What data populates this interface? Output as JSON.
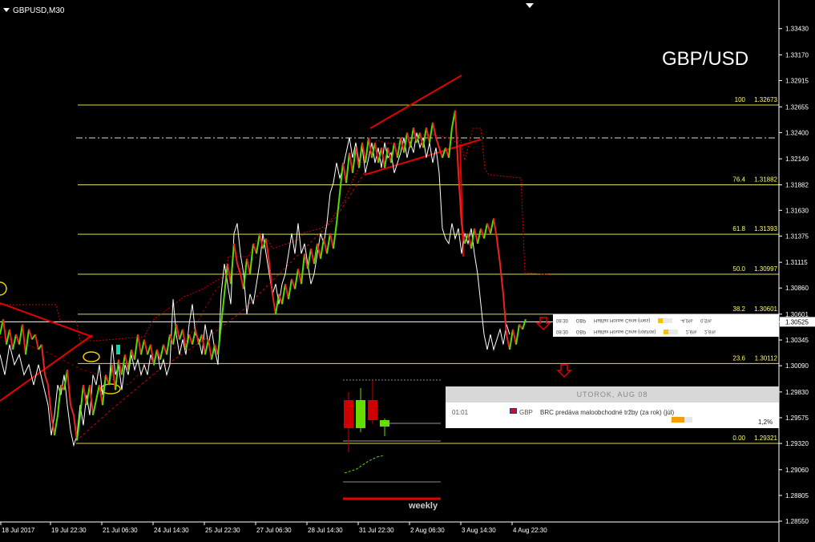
{
  "symbol": "GBPUSD,M30",
  "big_title": "GBP/USD",
  "chart_data": {
    "type": "line",
    "instrument": "GBPUSD",
    "timeframe": "M30",
    "ylim": [
      1.2855,
      1.3365
    ],
    "y_ticks": [
      "1.33430",
      "1.33170",
      "1.32915",
      "1.32655",
      "1.32400",
      "1.32140",
      "1.31882",
      "1.31630",
      "1.31375",
      "1.31115",
      "1.30860",
      "1.30601",
      "1.30525",
      "1.30345",
      "1.30090",
      "1.29830",
      "1.29575",
      "1.29320",
      "1.29060",
      "1.28805",
      "1.28550"
    ],
    "x_ticks": [
      "18 Jul 2017",
      "19 Jul 22:30",
      "21 Jul 06:30",
      "24 Jul 14:30",
      "25 Jul 22:30",
      "27 Jul 06:30",
      "28 Jul 14:30",
      "31 Jul 22:30",
      "2 Aug 06:30",
      "3 Aug 14:30",
      "4 Aug 22:30"
    ],
    "current_price": "1.30525",
    "fibonacci": [
      {
        "level": "100",
        "price": "1.32673",
        "value": 1.32673
      },
      {
        "level": "76.4",
        "price": "1.31882",
        "value": 1.31882
      },
      {
        "level": "61.8",
        "price": "1.31393",
        "value": 1.31393
      },
      {
        "level": "50.0",
        "price": "1.30997",
        "value": 1.30997
      },
      {
        "level": "38.2",
        "price": "1.30601",
        "value": 1.30601
      },
      {
        "level": "23.6",
        "price": "1.30112",
        "value": 1.30112
      },
      {
        "level": "0.00",
        "price": "1.29321",
        "value": 1.29321
      }
    ],
    "price_path": [
      [
        0,
        1.304
      ],
      [
        4,
        1.3055
      ],
      [
        8,
        1.303
      ],
      [
        12,
        1.3045
      ],
      [
        16,
        1.3025
      ],
      [
        20,
        1.304
      ],
      [
        24,
        1.303
      ],
      [
        28,
        1.305
      ],
      [
        32,
        1.302
      ],
      [
        36,
        1.3045
      ],
      [
        40,
        1.3035
      ],
      [
        44,
        1.304
      ],
      [
        48,
        1.3025
      ],
      [
        52,
        1.303
      ],
      [
        56,
        1.3
      ],
      [
        60,
        1.299
      ],
      [
        64,
        1.296
      ],
      [
        68,
        1.294
      ],
      [
        72,
        1.296
      ],
      [
        76,
        1.299
      ],
      [
        80,
        1.2985
      ],
      [
        84,
        1.3005
      ],
      [
        88,
        1.297
      ],
      [
        92,
        1.296
      ],
      [
        96,
        1.2935
      ],
      [
        100,
        1.296
      ],
      [
        104,
        1.299
      ],
      [
        108,
        1.297
      ],
      [
        112,
        1.299
      ],
      [
        116,
        1.296
      ],
      [
        120,
        1.2975
      ],
      [
        124,
        1.299
      ],
      [
        128,
        1.297
      ],
      [
        132,
        1.3
      ],
      [
        136,
        1.299
      ],
      [
        140,
        1.301
      ],
      [
        144,
        1.2985
      ],
      [
        148,
        1.3015
      ],
      [
        152,
        1.3
      ],
      [
        156,
        1.302
      ],
      [
        160,
        1.3005
      ],
      [
        164,
        1.3025
      ],
      [
        168,
        1.3015
      ],
      [
        172,
        1.304
      ],
      [
        176,
        1.302
      ],
      [
        180,
        1.3035
      ],
      [
        184,
        1.302
      ],
      [
        188,
        1.303
      ],
      [
        192,
        1.301
      ],
      [
        196,
        1.3025
      ],
      [
        200,
        1.3015
      ],
      [
        204,
        1.303
      ],
      [
        208,
        1.302
      ],
      [
        212,
        1.304
      ],
      [
        216,
        1.303
      ],
      [
        220,
        1.305
      ],
      [
        224,
        1.3035
      ],
      [
        228,
        1.3045
      ],
      [
        232,
        1.3025
      ],
      [
        236,
        1.304
      ],
      [
        240,
        1.303
      ],
      [
        244,
        1.3045
      ],
      [
        248,
        1.303
      ],
      [
        252,
        1.304
      ],
      [
        256,
        1.302
      ],
      [
        260,
        1.3035
      ],
      [
        264,
        1.3015
      ],
      [
        268,
        1.303
      ],
      [
        272,
        1.302
      ],
      [
        276,
        1.305
      ],
      [
        280,
        1.308
      ],
      [
        284,
        1.311
      ],
      [
        288,
        1.309
      ],
      [
        292,
        1.313
      ],
      [
        296,
        1.311
      ],
      [
        300,
        1.31
      ],
      [
        304,
        1.3085
      ],
      [
        308,
        1.3115
      ],
      [
        312,
        1.31
      ],
      [
        316,
        1.313
      ],
      [
        320,
        1.312
      ],
      [
        324,
        1.314
      ],
      [
        328,
        1.3125
      ],
      [
        332,
        1.3135
      ],
      [
        336,
        1.311
      ],
      [
        340,
        1.308
      ],
      [
        344,
        1.306
      ],
      [
        348,
        1.308
      ],
      [
        352,
        1.307
      ],
      [
        356,
        1.309
      ],
      [
        360,
        1.3075
      ],
      [
        364,
        1.3095
      ],
      [
        368,
        1.3085
      ],
      [
        372,
        1.3105
      ],
      [
        376,
        1.309
      ],
      [
        380,
        1.312
      ],
      [
        384,
        1.3105
      ],
      [
        388,
        1.3125
      ],
      [
        392,
        1.311
      ],
      [
        396,
        1.313
      ],
      [
        400,
        1.3115
      ],
      [
        404,
        1.3135
      ],
      [
        408,
        1.312
      ],
      [
        412,
        1.314
      ],
      [
        416,
        1.3125
      ],
      [
        420,
        1.315
      ],
      [
        424,
        1.318
      ],
      [
        428,
        1.321
      ],
      [
        432,
        1.319
      ],
      [
        436,
        1.322
      ],
      [
        440,
        1.32
      ],
      [
        444,
        1.3225
      ],
      [
        448,
        1.3205
      ],
      [
        452,
        1.323
      ],
      [
        456,
        1.321
      ],
      [
        460,
        1.3235
      ],
      [
        464,
        1.3215
      ],
      [
        468,
        1.323
      ],
      [
        472,
        1.321
      ],
      [
        476,
        1.3225
      ],
      [
        480,
        1.3205
      ],
      [
        484,
        1.3225
      ],
      [
        488,
        1.321
      ],
      [
        492,
        1.323
      ],
      [
        496,
        1.3215
      ],
      [
        500,
        1.3235
      ],
      [
        504,
        1.322
      ],
      [
        508,
        1.324
      ],
      [
        512,
        1.3225
      ],
      [
        516,
        1.3245
      ],
      [
        520,
        1.323
      ],
      [
        524,
        1.324
      ],
      [
        528,
        1.3225
      ],
      [
        532,
        1.3245
      ],
      [
        536,
        1.323
      ],
      [
        540,
        1.325
      ],
      [
        544,
        1.3235
      ],
      [
        548,
        1.3225
      ],
      [
        552,
        1.3215
      ],
      [
        556,
        1.3225
      ],
      [
        560,
        1.3215
      ],
      [
        564,
        1.3245
      ],
      [
        568,
        1.3262
      ],
      [
        572,
        1.32
      ],
      [
        576,
        1.315
      ],
      [
        580,
        1.313
      ],
      [
        584,
        1.314
      ],
      [
        588,
        1.3125
      ],
      [
        592,
        1.3145
      ],
      [
        596,
        1.313
      ],
      [
        600,
        1.3145
      ],
      [
        604,
        1.3135
      ],
      [
        608,
        1.315
      ],
      [
        612,
        1.314
      ],
      [
        616,
        1.3155
      ],
      [
        620,
        1.3135
      ],
      [
        624,
        1.311
      ],
      [
        628,
        1.308
      ],
      [
        632,
        1.304
      ],
      [
        636,
        1.3025
      ],
      [
        640,
        1.3045
      ],
      [
        644,
        1.303
      ],
      [
        648,
        1.305
      ],
      [
        652,
        1.3045
      ],
      [
        656,
        1.3055
      ]
    ],
    "white_path": [
      [
        0,
        1.302
      ],
      [
        6,
        1.3
      ],
      [
        12,
        1.303
      ],
      [
        18,
        1.301
      ],
      [
        24,
        1.302
      ],
      [
        30,
        1.3
      ],
      [
        36,
        1.301
      ],
      [
        42,
        1.299
      ],
      [
        48,
        1.301
      ],
      [
        54,
        1.299
      ],
      [
        60,
        1.297
      ],
      [
        64,
        1.294
      ],
      [
        68,
        1.296
      ],
      [
        72,
        1.299
      ],
      [
        76,
        1.298
      ],
      [
        80,
        1.3
      ],
      [
        84,
        1.297
      ],
      [
        88,
        1.2945
      ],
      [
        92,
        1.293
      ],
      [
        96,
        1.294
      ],
      [
        100,
        1.297
      ],
      [
        104,
        1.295
      ],
      [
        108,
        1.298
      ],
      [
        112,
        1.296
      ],
      [
        116,
        1.3
      ],
      [
        120,
        1.299
      ],
      [
        124,
        1.301
      ],
      [
        128,
        1.298
      ],
      [
        132,
        1.3
      ],
      [
        136,
        1.299
      ],
      [
        140,
        1.303
      ],
      [
        144,
        1.3
      ],
      [
        148,
        1.301
      ],
      [
        152,
        1.2985
      ],
      [
        156,
        1.301
      ],
      [
        160,
        1.3
      ],
      [
        164,
        1.302
      ],
      [
        168,
        1.3005
      ],
      [
        172,
        1.3015
      ],
      [
        176,
        1.3
      ],
      [
        180,
        1.301
      ],
      [
        184,
        1.3
      ],
      [
        188,
        1.302
      ],
      [
        192,
        1.301
      ],
      [
        196,
        1.3025
      ],
      [
        200,
        1.3005
      ],
      [
        204,
        1.3015
      ],
      [
        208,
        1.3
      ],
      [
        212,
        1.301
      ],
      [
        216,
        1.3075
      ],
      [
        220,
        1.304
      ],
      [
        224,
        1.302
      ],
      [
        228,
        1.3035
      ],
      [
        232,
        1.302
      ],
      [
        236,
        1.305
      ],
      [
        240,
        1.307
      ],
      [
        244,
        1.304
      ],
      [
        248,
        1.3035
      ],
      [
        252,
        1.302
      ],
      [
        256,
        1.305
      ],
      [
        260,
        1.303
      ],
      [
        264,
        1.3045
      ],
      [
        268,
        1.3025
      ],
      [
        272,
        1.301
      ],
      [
        276,
        1.308
      ],
      [
        280,
        1.311
      ],
      [
        284,
        1.309
      ],
      [
        288,
        1.307
      ],
      [
        292,
        1.314
      ],
      [
        296,
        1.315
      ],
      [
        300,
        1.312
      ],
      [
        304,
        1.31
      ],
      [
        308,
        1.306
      ],
      [
        312,
        1.308
      ],
      [
        316,
        1.307
      ],
      [
        320,
        1.309
      ],
      [
        324,
        1.311
      ],
      [
        328,
        1.314
      ],
      [
        332,
        1.312
      ],
      [
        336,
        1.31
      ],
      [
        340,
        1.308
      ],
      [
        344,
        1.309
      ],
      [
        348,
        1.307
      ],
      [
        352,
        1.309
      ],
      [
        356,
        1.31
      ],
      [
        360,
        1.312
      ],
      [
        364,
        1.314
      ],
      [
        368,
        1.312
      ],
      [
        372,
        1.315
      ],
      [
        376,
        1.312
      ],
      [
        380,
        1.313
      ],
      [
        384,
        1.311
      ],
      [
        388,
        1.309
      ],
      [
        392,
        1.31
      ],
      [
        396,
        1.312
      ],
      [
        400,
        1.314
      ],
      [
        404,
        1.313
      ],
      [
        408,
        1.315
      ],
      [
        412,
        1.318
      ],
      [
        416,
        1.319
      ],
      [
        420,
        1.321
      ],
      [
        424,
        1.3195
      ],
      [
        428,
        1.3205
      ],
      [
        432,
        1.322
      ],
      [
        436,
        1.3235
      ],
      [
        440,
        1.3215
      ],
      [
        444,
        1.323
      ],
      [
        448,
        1.321
      ],
      [
        452,
        1.3225
      ],
      [
        456,
        1.32
      ],
      [
        460,
        1.3215
      ],
      [
        464,
        1.323
      ],
      [
        468,
        1.321
      ],
      [
        472,
        1.3225
      ],
      [
        476,
        1.3205
      ],
      [
        480,
        1.323
      ],
      [
        484,
        1.3215
      ],
      [
        488,
        1.322
      ],
      [
        492,
        1.32
      ],
      [
        496,
        1.321
      ],
      [
        500,
        1.322
      ],
      [
        504,
        1.3235
      ],
      [
        508,
        1.3215
      ],
      [
        512,
        1.323
      ],
      [
        516,
        1.322
      ],
      [
        520,
        1.324
      ],
      [
        524,
        1.3225
      ],
      [
        528,
        1.3235
      ],
      [
        532,
        1.3215
      ],
      [
        536,
        1.323
      ],
      [
        540,
        1.321
      ],
      [
        544,
        1.3225
      ],
      [
        548,
        1.32
      ],
      [
        552,
        1.3145
      ],
      [
        556,
        1.3135
      ],
      [
        560,
        1.313
      ],
      [
        564,
        1.315
      ],
      [
        568,
        1.3135
      ],
      [
        572,
        1.3145
      ],
      [
        576,
        1.312
      ],
      [
        580,
        1.314
      ],
      [
        584,
        1.313
      ],
      [
        588,
        1.3145
      ],
      [
        592,
        1.312
      ],
      [
        596,
        1.31
      ],
      [
        600,
        1.307
      ],
      [
        604,
        1.304
      ],
      [
        608,
        1.3025
      ],
      [
        612,
        1.304
      ],
      [
        616,
        1.3025
      ],
      [
        620,
        1.3035
      ],
      [
        624,
        1.3045
      ],
      [
        628,
        1.303
      ],
      [
        632,
        1.305
      ],
      [
        636,
        1.304
      ]
    ],
    "weekly_candles": [
      {
        "open": 1.2975,
        "high": 1.2985,
        "low": 1.291,
        "close": 1.294,
        "color": "#d00000"
      },
      {
        "open": 1.294,
        "high": 1.299,
        "low": 1.2935,
        "close": 1.2975,
        "color": "#66dd00"
      },
      {
        "open": 1.2975,
        "high": 1.3,
        "low": 1.2945,
        "close": 1.295,
        "color": "#d00000"
      },
      {
        "open": 1.295,
        "high": 1.2952,
        "low": 1.293,
        "close": 1.2942,
        "color": "#66dd00"
      }
    ],
    "weekly_label": "weekly"
  },
  "news_strip": [
    {
      "time": "08:30",
      "cur": "GBP",
      "desc": "Halifax House Cena (mes)",
      "val": "-4,0%",
      "prev": "0,5%"
    },
    {
      "time": "08:30",
      "cur": "GBP",
      "desc": "Halifax House Cena (rok/rok)",
      "val": "2,6%",
      "prev": "2,6%"
    }
  ],
  "calendar": {
    "header": "UTOROK, AUG 08",
    "time": "01:01",
    "currency": "GBP",
    "description": "BRC predáva maloobchodné tržby (za rok) (júl)",
    "value": "1,2%"
  }
}
